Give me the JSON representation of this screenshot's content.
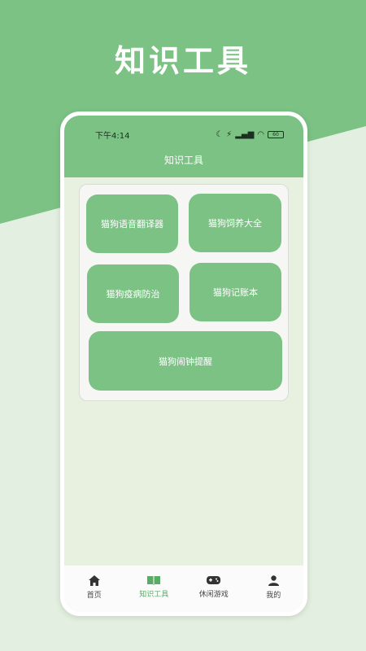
{
  "hero": {
    "title": "知识工具"
  },
  "status_bar": {
    "time": "下午4:14",
    "battery": "60"
  },
  "header": {
    "title": "知识工具"
  },
  "tools": [
    {
      "label": "猫狗语音翻译器"
    },
    {
      "label": "猫狗饲养大全"
    },
    {
      "label": "猫狗疫病防治"
    },
    {
      "label": "猫狗记账本"
    },
    {
      "label": "猫狗闹钟提醒"
    }
  ],
  "nav": [
    {
      "label": "首页",
      "icon": "home-icon"
    },
    {
      "label": "知识工具",
      "icon": "book-icon",
      "active": true
    },
    {
      "label": "休闲游戏",
      "icon": "gamepad-icon"
    },
    {
      "label": "我的",
      "icon": "user-icon"
    }
  ],
  "colors": {
    "accent": "#7cc285",
    "background": "#e3efe0",
    "active_nav": "#5aab66"
  }
}
